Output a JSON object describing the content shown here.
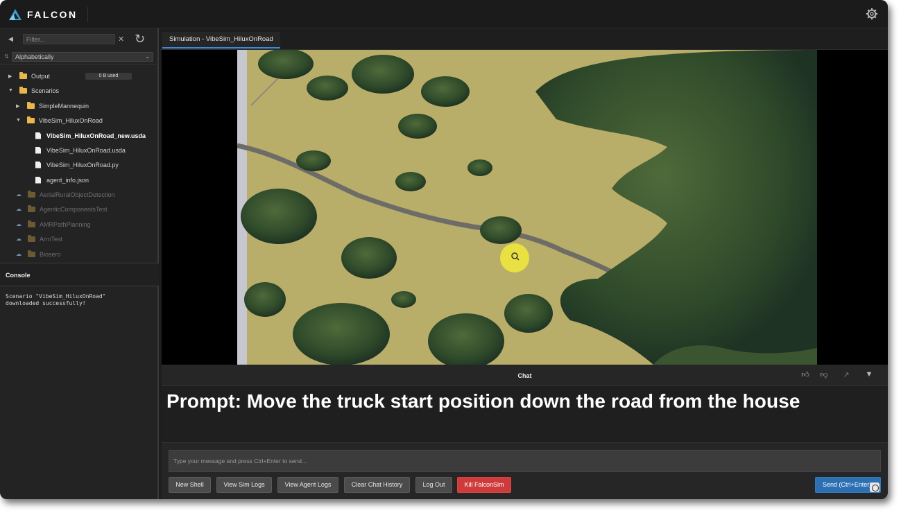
{
  "app": {
    "name": "FALCON",
    "brand_color": "#3f9ccf"
  },
  "sidebar": {
    "filter_placeholder": "Filter...",
    "sort_label": "Alphabetically",
    "tree": [
      {
        "label": "Output",
        "type": "folder",
        "state": "collapsed",
        "badge": "0 B used"
      },
      {
        "label": "Scenarios",
        "type": "folder",
        "state": "expanded"
      },
      {
        "label": "SimpleMannequin",
        "type": "folder",
        "state": "collapsed"
      },
      {
        "label": "VibeSim_HiluxOnRoad",
        "type": "folder",
        "state": "expanded"
      },
      {
        "label": "VibeSim_HiluxOnRoad_new.usda",
        "type": "file",
        "state": "selected"
      },
      {
        "label": "VibeSim_HiluxOnRoad.usda",
        "type": "file"
      },
      {
        "label": "VibeSim_HiluxOnRoad.py",
        "type": "file"
      },
      {
        "label": "agent_info.json",
        "type": "file"
      },
      {
        "label": "AerialRuralObjectDetection",
        "type": "cloud-folder"
      },
      {
        "label": "AgenticComponentsTest",
        "type": "cloud-folder"
      },
      {
        "label": "AMRPathPlanning",
        "type": "cloud-folder"
      },
      {
        "label": "ArmTest",
        "type": "cloud-folder"
      },
      {
        "label": "Biosero",
        "type": "cloud-folder"
      }
    ]
  },
  "console": {
    "title": "Console",
    "text": "Scenario \"VibeSim_HiluxOnRoad\"\ndownloaded successfully!"
  },
  "main": {
    "tab_label": "Simulation - VibeSim_HiluxOnRoad"
  },
  "chat": {
    "title": "Chat",
    "prompt_text": "Prompt: Move the truck start position down the road from the house",
    "input_placeholder": "Type your message and press Ctrl+Enter to send...",
    "buttons": {
      "new_shell": "New Shell",
      "view_sim_logs": "View Sim Logs",
      "view_agent_logs": "View Agent Logs",
      "clear_history": "Clear Chat History",
      "log_out": "Log Out",
      "kill": "Kill FalconSim",
      "send": "Send (Ctrl+Enter)"
    },
    "colors": {
      "kill": "#cf3b3b",
      "send": "#2c6fb3",
      "tab_accent": "#3d8bd8"
    }
  },
  "icons": {
    "settings": "gear-icon",
    "refresh": "refresh-icon",
    "thumbs_up": "thumbs-up-icon",
    "thumbs_down": "thumbs-down-icon",
    "expand": "expand-icon",
    "collapse": "chevron-down-icon"
  }
}
